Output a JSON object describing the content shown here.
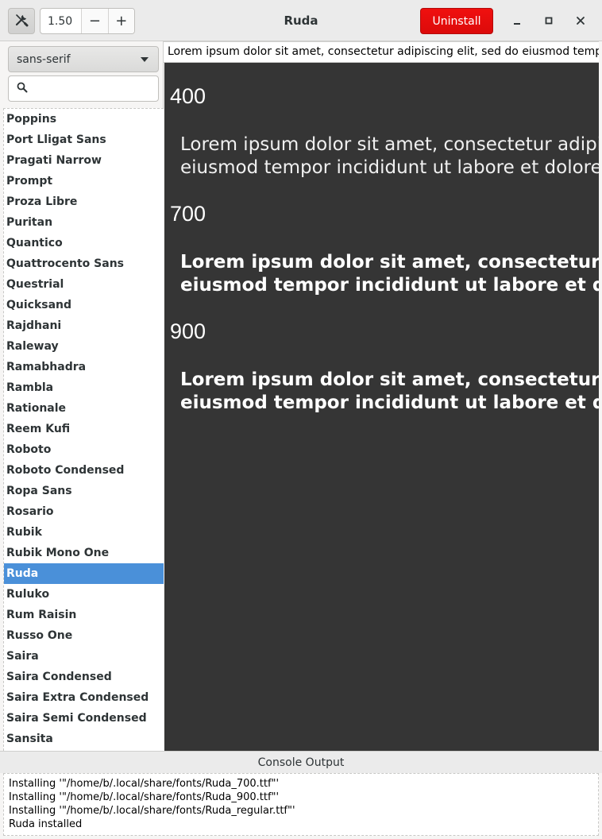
{
  "window": {
    "title": "Ruda"
  },
  "toolbar": {
    "scale_value": "1.50",
    "decrement_label": "−",
    "increment_label": "+",
    "uninstall_label": "Uninstall"
  },
  "sidebar": {
    "category_selected": "sans-serif",
    "search_placeholder": "",
    "fonts": [
      "Poppins",
      "Port Lligat Sans",
      "Pragati Narrow",
      "Prompt",
      "Proza Libre",
      "Puritan",
      "Quantico",
      "Quattrocento Sans",
      "Questrial",
      "Quicksand",
      "Rajdhani",
      "Raleway",
      "Ramabhadra",
      "Rambla",
      "Rationale",
      "Reem Kufi",
      "Roboto",
      "Roboto Condensed",
      "Ropa Sans",
      "Rosario",
      "Rubik",
      "Rubik Mono One",
      "Ruda",
      "Ruluko",
      "Rum Raisin",
      "Russo One",
      "Saira",
      "Saira Condensed",
      "Saira Extra Condensed",
      "Saira Semi Condensed",
      "Sansita"
    ],
    "selected_font": "Ruda"
  },
  "preview": {
    "input_text": "Lorem ipsum dolor sit amet, consectetur adipiscing elit, sed do eiusmod tempor incididunt ut labore et dolore magna aliqua.",
    "weights": [
      {
        "label": "400",
        "line1": "Lorem ipsum dolor sit amet, consectetur adipiscing elit, sed do",
        "line2": "eiusmod tempor incididunt ut labore et dolore magna aliqua."
      },
      {
        "label": "700",
        "line1": "Lorem ipsum dolor sit amet, consectetur adipiscing elit, sed do",
        "line2": "eiusmod tempor incididunt ut labore et dolore magna aliqua."
      },
      {
        "label": "900",
        "line1": "Lorem ipsum dolor sit amet, consectetur adipiscing elit, sed do",
        "line2": "eiusmod tempor incididunt ut labore et dolore magna aliqua."
      }
    ]
  },
  "console": {
    "header": "Console Output",
    "lines": [
      "Installing '\"/home/b/.local/share/fonts/Ruda_700.ttf\"'",
      "Installing '\"/home/b/.local/share/fonts/Ruda_900.ttf\"'",
      "Installing '\"/home/b/.local/share/fonts/Ruda_regular.ttf\"'",
      "Ruda installed"
    ]
  },
  "colors": {
    "accent": "#4a90d9",
    "destructive": "#e01010",
    "preview_bg": "#353535"
  }
}
